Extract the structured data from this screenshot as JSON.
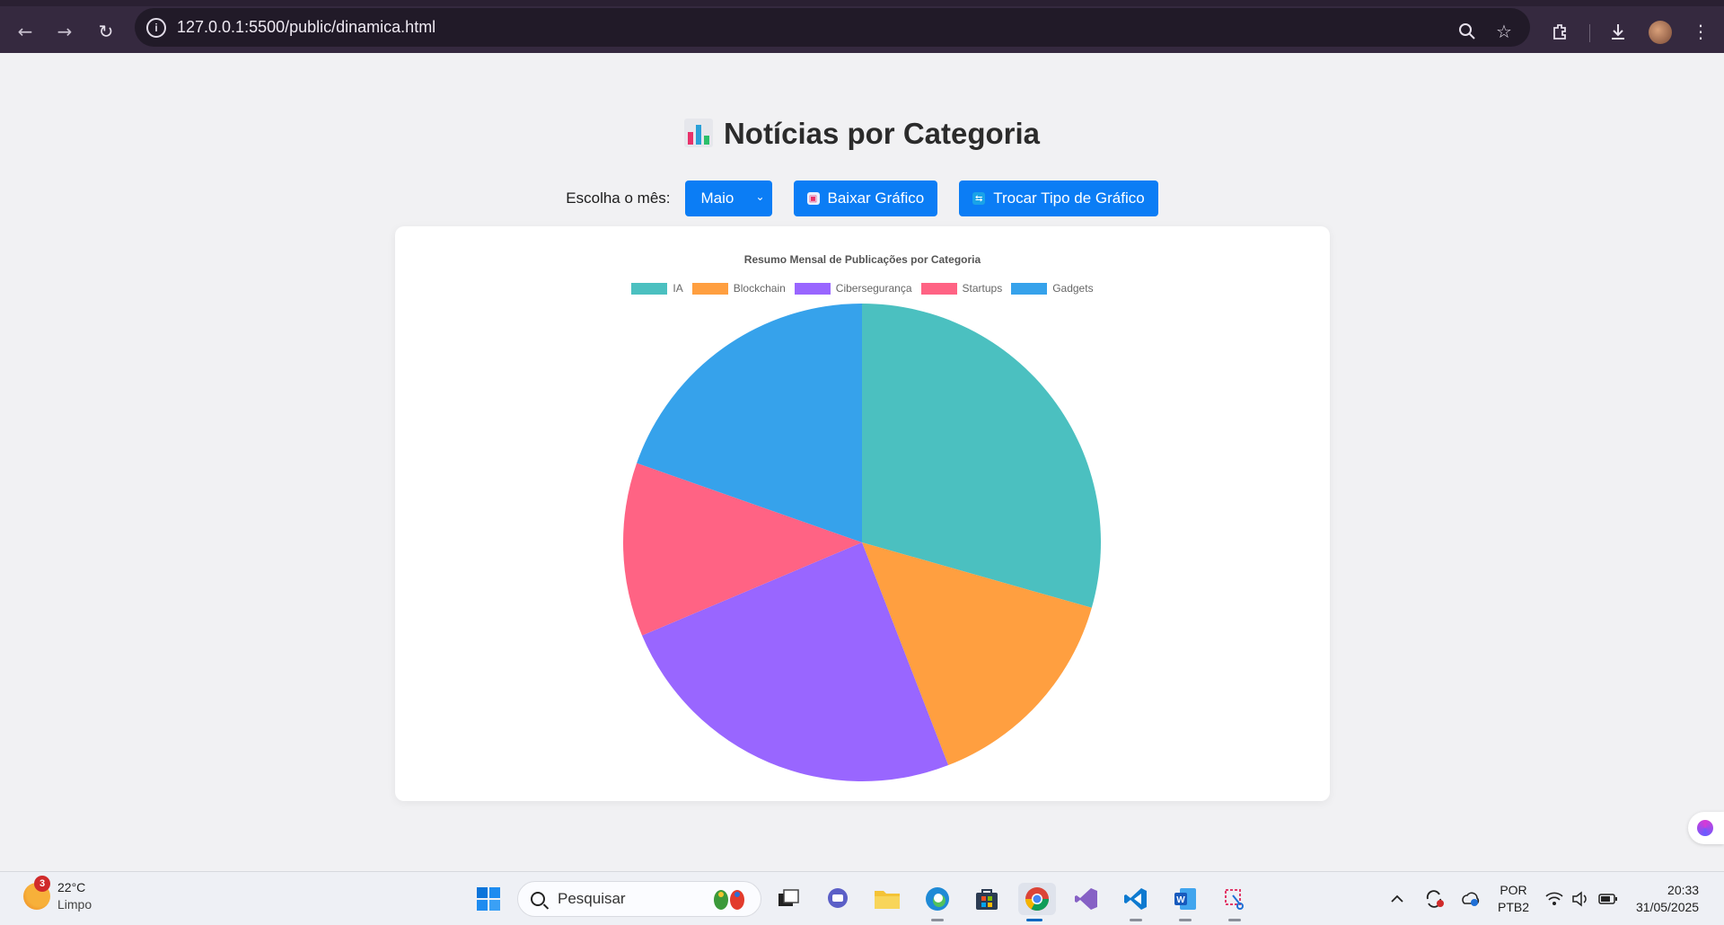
{
  "browser": {
    "url": "127.0.0.1:5500/public/dinamica.html"
  },
  "page": {
    "title": "Notícias por Categoria",
    "month_label": "Escolha o mês:",
    "month_selected": "Maio",
    "download_button": "Baixar Gráfico",
    "toggle_button": "Trocar Tipo de Gráfico"
  },
  "chart_data": {
    "type": "pie",
    "title": "Resumo Mensal de Publicações por Categoria",
    "categories": [
      "IA",
      "Blockchain",
      "Cibersegurança",
      "Startups",
      "Gadgets"
    ],
    "values": [
      30,
      15,
      25,
      12,
      20
    ],
    "colors": [
      "#4bc0c0",
      "#ff9f40",
      "#9966ff",
      "#ff6384",
      "#36a2eb"
    ],
    "legend_position": "top"
  },
  "taskbar": {
    "weather_temp": "22°C",
    "weather_desc": "Limpo",
    "weather_badge": "3",
    "search_placeholder": "Pesquisar",
    "lang_top": "POR",
    "lang_bottom": "PTB2",
    "time": "20:33",
    "date": "31/05/2025"
  }
}
